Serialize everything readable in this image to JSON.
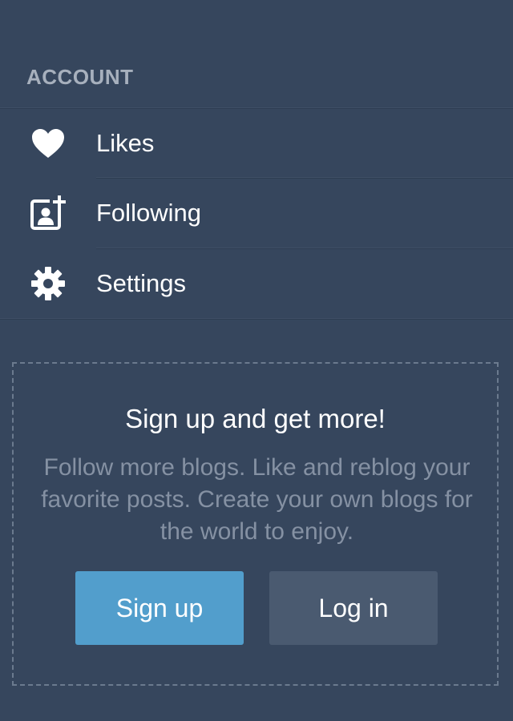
{
  "account": {
    "header": "ACCOUNT",
    "items": [
      {
        "label": "Likes",
        "icon": "heart-icon"
      },
      {
        "label": "Following",
        "icon": "following-icon"
      },
      {
        "label": "Settings",
        "icon": "gear-icon"
      }
    ]
  },
  "promo": {
    "title": "Sign up and get more!",
    "description": "Follow more blogs. Like and reblog your favorite posts. Create your own blogs for the world to enjoy.",
    "signup_label": "Sign up",
    "login_label": "Log in"
  },
  "colors": {
    "background": "#36465d",
    "signup_button": "#529ecc",
    "login_button": "#4a5a70",
    "muted_text": "#8591a3"
  }
}
